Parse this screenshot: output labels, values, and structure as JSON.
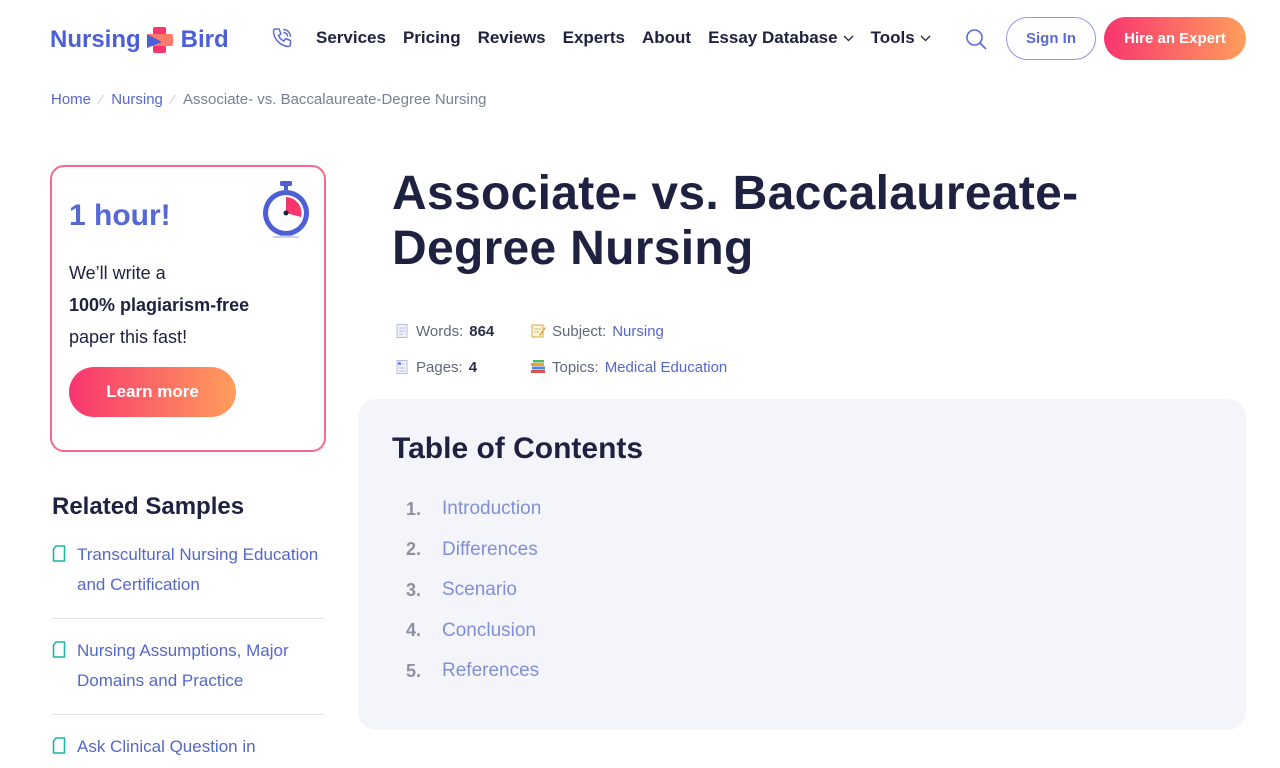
{
  "header": {
    "logo_left": "Nursing",
    "logo_right": "Bird",
    "nav": [
      {
        "label": "Services",
        "dropdown": false
      },
      {
        "label": "Pricing",
        "dropdown": false
      },
      {
        "label": "Reviews",
        "dropdown": false
      },
      {
        "label": "Experts",
        "dropdown": false
      },
      {
        "label": "About",
        "dropdown": false
      },
      {
        "label": "Essay Database",
        "dropdown": true
      },
      {
        "label": "Tools",
        "dropdown": true
      }
    ],
    "signin_label": "Sign In",
    "hire_label": "Hire an Expert"
  },
  "breadcrumb": {
    "home": "Home",
    "section": "Nursing",
    "current": "Associate- vs. Baccalaureate-Degree Nursing"
  },
  "promo": {
    "title": "1 hour!",
    "line1": "We’ll write a",
    "line2": "100% plagiarism-free",
    "line3": "paper this fast!",
    "button": "Learn more"
  },
  "related": {
    "title": "Related Samples",
    "items": [
      "Transcultural Nursing Education and Certification",
      "Nursing Assumptions, Major Domains and Practice",
      "Ask Clinical Question in"
    ]
  },
  "article": {
    "title": "Associate- vs. Baccalaureate-Degree Nursing",
    "meta": {
      "words_label": "Words:",
      "words_value": "864",
      "subject_label": "Subject:",
      "subject_value": "Nursing",
      "pages_label": "Pages:",
      "pages_value": "4",
      "topics_label": "Topics:",
      "topics_value": "Medical Education"
    }
  },
  "toc": {
    "title": "Table of Contents",
    "items": [
      {
        "num": "1.",
        "label": "Introduction"
      },
      {
        "num": "2.",
        "label": "Differences"
      },
      {
        "num": "3.",
        "label": "Scenario"
      },
      {
        "num": "4.",
        "label": "Conclusion"
      },
      {
        "num": "5.",
        "label": "References"
      }
    ]
  },
  "colors": {
    "brand_blue": "#4c5fd5",
    "accent_pink": "#f8356f",
    "accent_orange": "#ff9e5c",
    "link": "#5468c8",
    "toc_bg": "#f4f5fa"
  },
  "icons": [
    "phone-icon",
    "search-icon",
    "chevron-down-icon",
    "stopwatch-icon",
    "document-icon",
    "page-icon",
    "memo-icon",
    "books-icon"
  ]
}
